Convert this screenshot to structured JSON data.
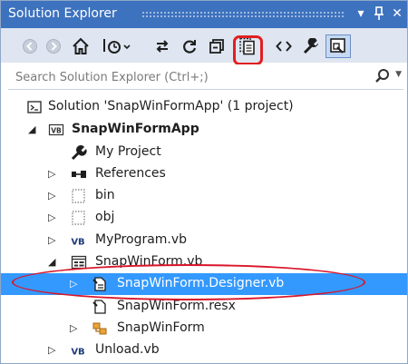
{
  "window": {
    "title": "Solution Explorer",
    "buttons": [
      "▾",
      "⊓",
      "✕"
    ]
  },
  "toolbar": {
    "items": [
      "back-icon",
      "forward-icon",
      "home-icon",
      "pending-changes-icon",
      "sync-icon",
      "refresh-icon",
      "collapse-all-icon",
      "show-all-files-icon",
      "view-code-icon",
      "properties-icon",
      "preview-icon"
    ],
    "highlighted": "show-all-files-icon"
  },
  "search": {
    "placeholder": "Search Solution Explorer (Ctrl+;)"
  },
  "tree": [
    {
      "label": "Solution 'SnapWinFormApp' (1 project)",
      "icon": "solution-icon",
      "expanded": null
    },
    {
      "label": "SnapWinFormApp",
      "icon": "vb-project-icon",
      "expanded": true,
      "bold": true
    },
    {
      "label": "My Project",
      "icon": "wrench-icon",
      "expanded": null
    },
    {
      "label": "References",
      "icon": "references-icon",
      "expanded": false
    },
    {
      "label": "bin",
      "icon": "folder-dotted-icon",
      "expanded": false
    },
    {
      "label": "obj",
      "icon": "folder-dotted-icon",
      "expanded": false
    },
    {
      "label": "MyProgram.vb",
      "icon": "vb-file-icon",
      "expanded": false
    },
    {
      "label": "SnapWinForm.vb",
      "icon": "form-icon",
      "expanded": true
    },
    {
      "label": "SnapWinForm.Designer.vb",
      "icon": "designer-file-icon",
      "expanded": false,
      "selected": true
    },
    {
      "label": "SnapWinForm.resx",
      "icon": "resx-file-icon",
      "expanded": null
    },
    {
      "label": "SnapWinForm",
      "icon": "class-icon",
      "expanded": false
    },
    {
      "label": "Unload.vb",
      "icon": "vb-file-icon",
      "expanded": false
    }
  ],
  "colors": {
    "titlebar": "#3d72be",
    "toolbar": "#dfe6f1",
    "selection": "#3399ff",
    "annotation": "#e02020"
  }
}
